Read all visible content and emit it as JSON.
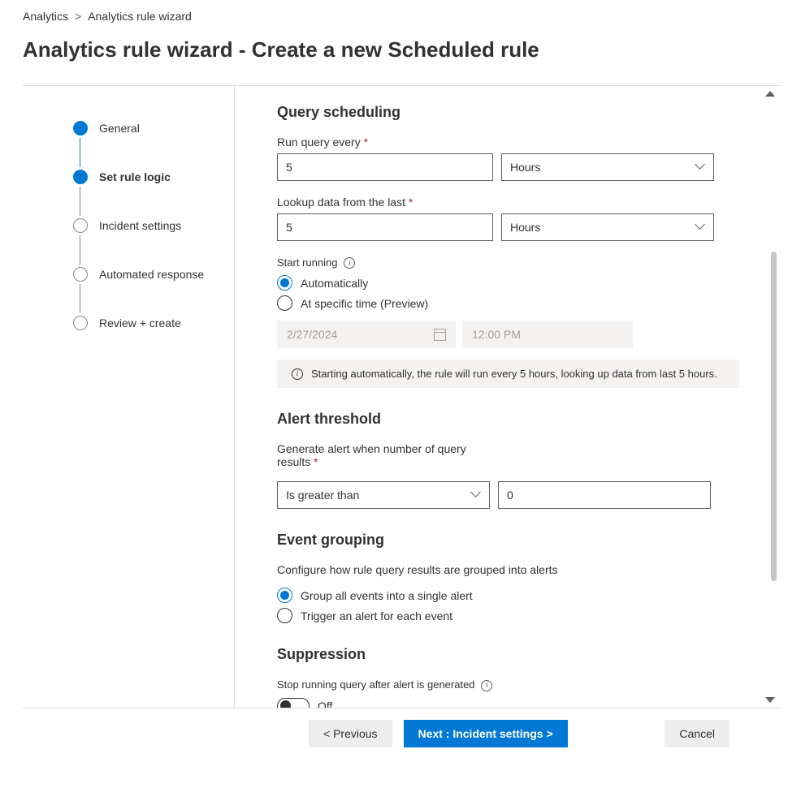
{
  "breadcrumb": {
    "root": "Analytics",
    "current": "Analytics rule wizard"
  },
  "page_title": "Analytics rule wizard - Create a new Scheduled rule",
  "steps": [
    {
      "label": "General"
    },
    {
      "label": "Set rule logic"
    },
    {
      "label": "Incident settings"
    },
    {
      "label": "Automated response"
    },
    {
      "label": "Review + create"
    }
  ],
  "scheduling": {
    "heading": "Query scheduling",
    "run_label": "Run query every",
    "run_value": "5",
    "run_unit": "Hours",
    "lookup_label": "Lookup data from the last",
    "lookup_value": "5",
    "lookup_unit": "Hours",
    "start_label": "Start running",
    "start_options": {
      "auto": "Automatically",
      "specific": "At specific time (Preview)"
    },
    "date_value": "2/27/2024",
    "time_value": "12:00 PM",
    "info_text": "Starting automatically, the rule will run every 5 hours, looking up data from last 5 hours."
  },
  "threshold": {
    "heading": "Alert threshold",
    "label": "Generate alert when number of query results",
    "operator": "Is greater than",
    "value": "0"
  },
  "grouping": {
    "heading": "Event grouping",
    "label": "Configure how rule query results are grouped into alerts",
    "options": {
      "single": "Group all events into a single alert",
      "each": "Trigger an alert for each event"
    }
  },
  "suppression": {
    "heading": "Suppression",
    "label": "Stop running query after alert is generated",
    "state": "Off"
  },
  "footer": {
    "previous": "< Previous",
    "next": "Next : Incident settings >",
    "cancel": "Cancel"
  }
}
